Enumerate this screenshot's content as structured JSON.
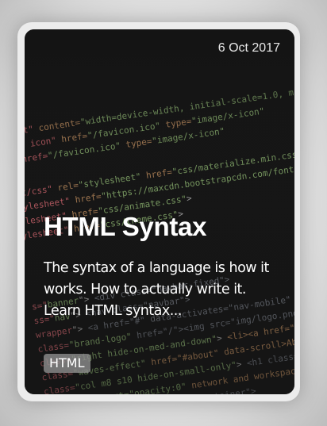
{
  "card": {
    "date": "6 Oct 2017",
    "title": "HTML Syntax",
    "excerpt": "The syntax of a language is how it works. How to actually write it. Learn HTML syntax...",
    "tag": "HTML"
  }
}
